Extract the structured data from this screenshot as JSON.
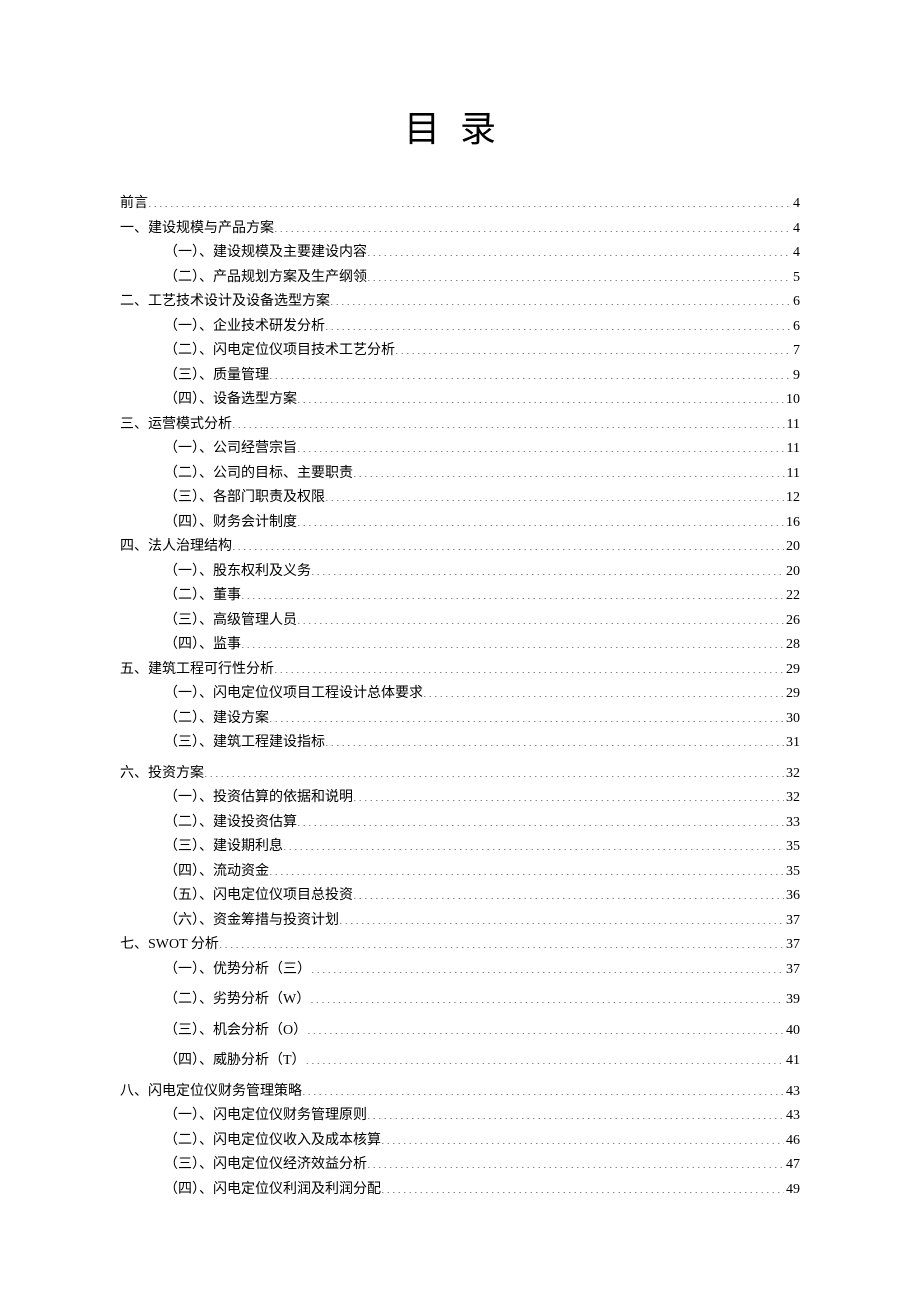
{
  "title": "目录",
  "toc": [
    {
      "level": 0,
      "label": "前言",
      "page": "4"
    },
    {
      "level": 0,
      "label": "一、建设规模与产品方案",
      "page": "4"
    },
    {
      "level": 1,
      "label": "（一）、建设规模及主要建设内容",
      "page": "4"
    },
    {
      "level": 1,
      "label": "（二）、产品规划方案及生产纲领",
      "page": "5"
    },
    {
      "level": 0,
      "label": "二、工艺技术设计及设备选型方案",
      "page": "6"
    },
    {
      "level": 1,
      "label": "（一）、企业技术研发分析",
      "page": "6"
    },
    {
      "level": 1,
      "label": "（二）、闪电定位仪项目技术工艺分析",
      "page": "7"
    },
    {
      "level": 1,
      "label": "（三）、质量管理",
      "page": "9"
    },
    {
      "level": 1,
      "label": "（四）、设备选型方案",
      "page": "10"
    },
    {
      "level": 0,
      "label": "三、运营模式分析",
      "page": "11"
    },
    {
      "level": 1,
      "label": "（一）、公司经营宗旨",
      "page": "11"
    },
    {
      "level": 1,
      "label": "（二）、公司的目标、主要职责",
      "page": "11"
    },
    {
      "level": 1,
      "label": "（三）、各部门职责及权限",
      "page": "12"
    },
    {
      "level": 1,
      "label": "（四）、财务会计制度",
      "page": "16"
    },
    {
      "level": 0,
      "label": "四、法人治理结构",
      "page": "20"
    },
    {
      "level": 1,
      "label": "（一）、股东权利及义务",
      "page": "20"
    },
    {
      "level": 1,
      "label": "（二）、董事",
      "page": "22"
    },
    {
      "level": 1,
      "label": "（三）、高级管理人员",
      "page": "26"
    },
    {
      "level": 1,
      "label": "（四）、监事",
      "page": "28"
    },
    {
      "level": 0,
      "label": "五、建筑工程可行性分析",
      "page": "29"
    },
    {
      "level": 1,
      "label": "（一）、闪电定位仪项目工程设计总体要求",
      "page": "29"
    },
    {
      "level": 1,
      "label": "（二）、建设方案",
      "page": "30"
    },
    {
      "level": 1,
      "label": "（三）、建筑工程建设指标",
      "page": "31"
    },
    {
      "gap": true
    },
    {
      "level": 0,
      "label": "六、投资方案",
      "page": "32"
    },
    {
      "level": 1,
      "label": "（一）、投资估算的依据和说明",
      "page": "32"
    },
    {
      "level": 1,
      "label": "（二）、建设投资估算",
      "page": "33"
    },
    {
      "level": 1,
      "label": "（三）、建设期利息",
      "page": "35"
    },
    {
      "level": 1,
      "label": "（四）、流动资金",
      "page": "35"
    },
    {
      "level": 1,
      "label": "（五）、闪电定位仪项目总投资",
      "page": "36"
    },
    {
      "level": 1,
      "label": "（六）、资金筹措与投资计划",
      "page": "37"
    },
    {
      "level": 0,
      "label": "七、SWOT 分析",
      "page": "37"
    },
    {
      "level": 1,
      "label": "（一）、优势分析（三）",
      "page": "37"
    },
    {
      "gap": true
    },
    {
      "level": 1,
      "label": "（二）、劣势分析（W）",
      "page": "39"
    },
    {
      "gap": true
    },
    {
      "level": 1,
      "label": "（三）、机会分析（O）",
      "page": "40"
    },
    {
      "gap": true
    },
    {
      "level": 1,
      "label": "（四）、威胁分析（T）",
      "page": "41"
    },
    {
      "gap": true
    },
    {
      "level": 0,
      "label": "八、闪电定位仪财务管理策略",
      "page": "43"
    },
    {
      "level": 1,
      "label": "（一）、闪电定位仪财务管理原则",
      "page": "43"
    },
    {
      "level": 1,
      "label": "（二）、闪电定位仪收入及成本核算",
      "page": "46"
    },
    {
      "level": 1,
      "label": "（三）、闪电定位仪经济效益分析",
      "page": "47"
    },
    {
      "level": 1,
      "label": "（四）、闪电定位仪利润及利润分配",
      "page": "49"
    }
  ]
}
